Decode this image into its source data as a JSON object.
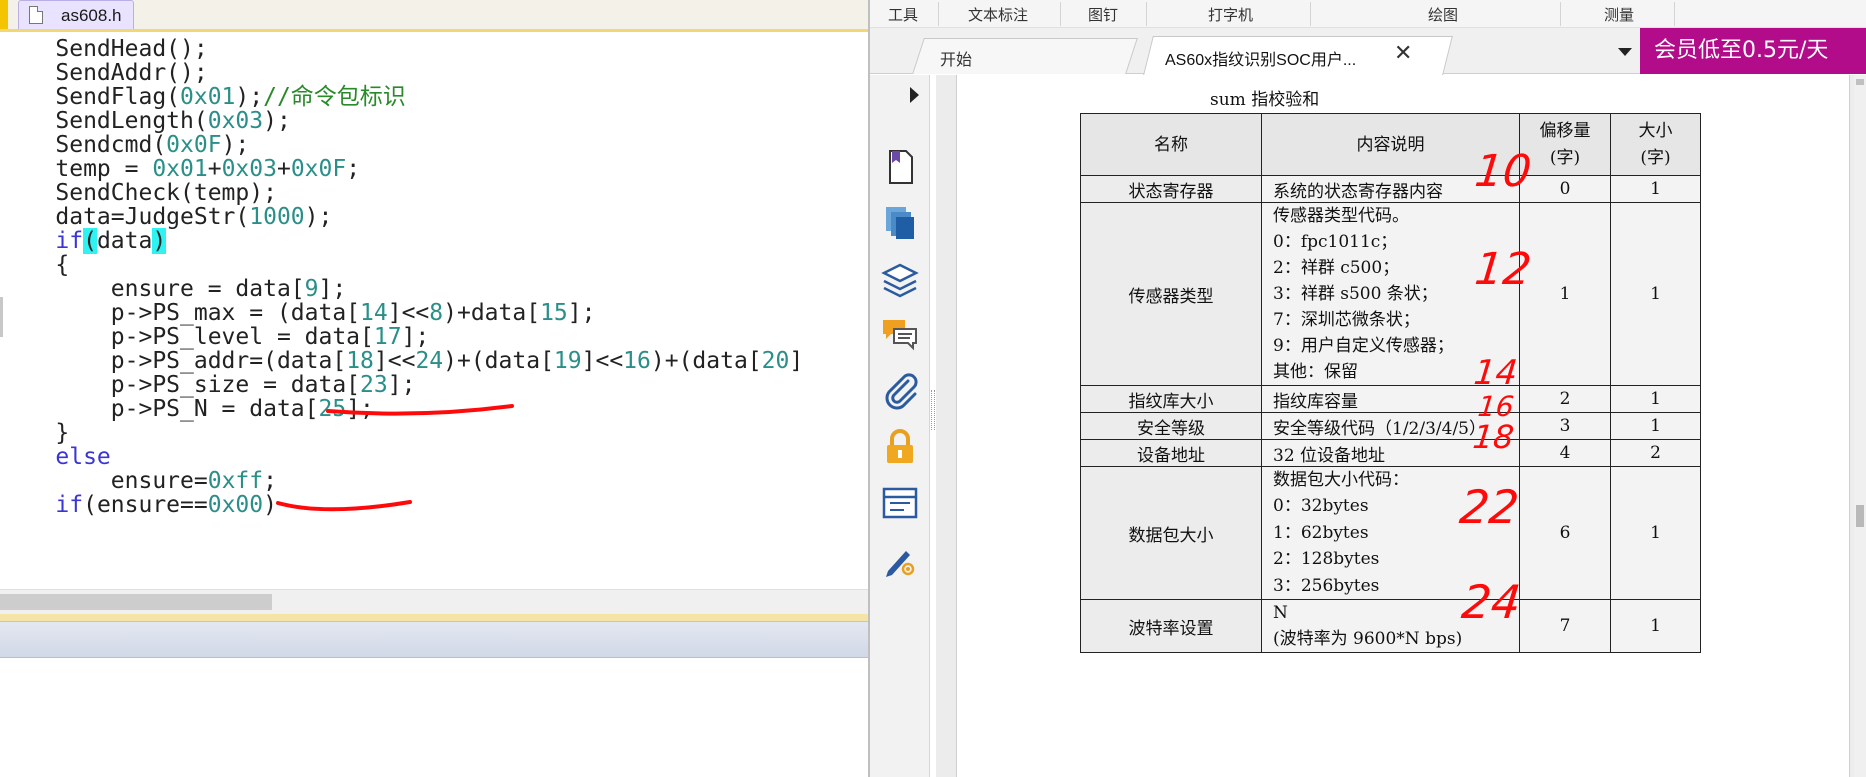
{
  "editor": {
    "tab_label": "as608.h",
    "code_lines": [
      {
        "parts": [
          {
            "t": "    SendHead();"
          }
        ]
      },
      {
        "parts": [
          {
            "t": "    SendAddr();"
          }
        ]
      },
      {
        "parts": [
          {
            "t": "    SendFlag("
          },
          {
            "t": "0x01",
            "c": "n"
          },
          {
            "t": ");"
          },
          {
            "t": "//命令包标识",
            "c": "cm"
          }
        ]
      },
      {
        "parts": [
          {
            "t": "    SendLength("
          },
          {
            "t": "0x03",
            "c": "n"
          },
          {
            "t": ");"
          }
        ]
      },
      {
        "parts": [
          {
            "t": "    Sendcmd("
          },
          {
            "t": "0x0F",
            "c": "n"
          },
          {
            "t": ");"
          }
        ]
      },
      {
        "parts": [
          {
            "t": "    temp = "
          },
          {
            "t": "0x01",
            "c": "n"
          },
          {
            "t": "+"
          },
          {
            "t": "0x03",
            "c": "n"
          },
          {
            "t": "+"
          },
          {
            "t": "0x0F",
            "c": "n"
          },
          {
            "t": ";"
          }
        ]
      },
      {
        "parts": [
          {
            "t": "    SendCheck(temp);"
          }
        ]
      },
      {
        "parts": [
          {
            "t": "    data=JudgeStr("
          },
          {
            "t": "1000",
            "c": "n"
          },
          {
            "t": ");"
          }
        ]
      },
      {
        "parts": [
          {
            "t": "    "
          },
          {
            "t": "if",
            "c": "k"
          },
          {
            "t": "(",
            "c": "hl"
          },
          {
            "t": "data"
          },
          {
            "t": ")",
            "c": "hl"
          }
        ]
      },
      {
        "parts": [
          {
            "t": "    {"
          }
        ]
      },
      {
        "parts": [
          {
            "t": "        ensure = data["
          },
          {
            "t": "9",
            "c": "n"
          },
          {
            "t": "];"
          }
        ]
      },
      {
        "parts": [
          {
            "t": "        p->PS_max = (data["
          },
          {
            "t": "14",
            "c": "n"
          },
          {
            "t": "]<<"
          },
          {
            "t": "8",
            "c": "n"
          },
          {
            "t": ")+data["
          },
          {
            "t": "15",
            "c": "n"
          },
          {
            "t": "];"
          }
        ]
      },
      {
        "parts": [
          {
            "t": "        p->PS_level = data["
          },
          {
            "t": "17",
            "c": "n"
          },
          {
            "t": "];"
          }
        ]
      },
      {
        "parts": [
          {
            "t": "        p->PS_addr=(data["
          },
          {
            "t": "18",
            "c": "n"
          },
          {
            "t": "]<<"
          },
          {
            "t": "24",
            "c": "n"
          },
          {
            "t": ")+(data["
          },
          {
            "t": "19",
            "c": "n"
          },
          {
            "t": "]<<"
          },
          {
            "t": "16",
            "c": "n"
          },
          {
            "t": ")+(data["
          },
          {
            "t": "20",
            "c": "n"
          },
          {
            "t": "]"
          }
        ]
      },
      {
        "parts": [
          {
            "t": "        p->PS_size = data["
          },
          {
            "t": "23",
            "c": "n"
          },
          {
            "t": "];"
          }
        ]
      },
      {
        "parts": [
          {
            "t": "        p->PS_N = data["
          },
          {
            "t": "25",
            "c": "n"
          },
          {
            "t": "];"
          }
        ]
      },
      {
        "parts": [
          {
            "t": "    }"
          }
        ]
      },
      {
        "parts": [
          {
            "t": "    "
          },
          {
            "t": "else",
            "c": "k"
          }
        ]
      },
      {
        "parts": [
          {
            "t": "        ensure="
          },
          {
            "t": "0xff",
            "c": "n"
          },
          {
            "t": ";"
          }
        ]
      },
      {
        "parts": [
          {
            "t": "    "
          },
          {
            "t": "if",
            "c": "k"
          },
          {
            "t": "(ensure=="
          },
          {
            "t": "0x00",
            "c": "n"
          },
          {
            "t": ")"
          }
        ]
      }
    ]
  },
  "viewer": {
    "menu": [
      "工具",
      "文本标注",
      "图钉",
      "打字机",
      "绘图",
      "测量"
    ],
    "tabs": {
      "home": "开始",
      "doc": "AS60x指纹识别SOC用户...",
      "close_icon": "close-icon"
    },
    "promo": "会员低至0.5元/天",
    "sidebar_icons": [
      "page-thumbnail-icon",
      "pages-icon",
      "layers-icon",
      "comments-icon",
      "attachment-icon",
      "security-lock-icon",
      "form-fields-icon",
      "signature-pen-icon"
    ],
    "caption": "sum 指校验和",
    "table": {
      "headers": [
        "名称",
        "内容说明",
        "偏移量",
        "(字)",
        "大小",
        "(字)"
      ],
      "rows": [
        {
          "name": "状态寄存器",
          "desc": [
            "系统的状态寄存器内容"
          ],
          "offset": "0",
          "size": "1"
        },
        {
          "name": "传感器类型",
          "desc": [
            "传感器类型代码。",
            "0：fpc1011c；",
            "2：祥群 c500；",
            "3：祥群 s500 条状；",
            "7：深圳芯微条状；",
            "9：用户自定义传感器；",
            "其他：保留"
          ],
          "offset": "1",
          "size": "1"
        },
        {
          "name": "指纹库大小",
          "desc": [
            "指纹库容量"
          ],
          "offset": "2",
          "size": "1"
        },
        {
          "name": "安全等级",
          "desc": [
            "安全等级代码（1/2/3/4/5）"
          ],
          "offset": "3",
          "size": "1"
        },
        {
          "name": "设备地址",
          "desc": [
            "32 位设备地址"
          ],
          "offset": "4",
          "size": "2"
        },
        {
          "name": "数据包大小",
          "desc": [
            "数据包大小代码：",
            "0：32bytes",
            "1：62bytes",
            "2：128bytes",
            "3：256bytes"
          ],
          "offset": "6",
          "size": "1"
        },
        {
          "name": "波特率设置",
          "desc": [
            "N",
            "(波特率为 9600*N bps)"
          ],
          "offset": "7",
          "size": "1"
        }
      ]
    },
    "annotations": [
      "10",
      "12",
      "14",
      "16",
      "18",
      "22",
      "24"
    ]
  },
  "colors": {
    "keyword": "#3a36d6",
    "number": "#2a8f88",
    "comment": "#2a8a2a",
    "bracket_highlight": "#2ff2f2",
    "handwriting_red": "#ff0a0a",
    "promo_bg": "#b30c8a"
  }
}
